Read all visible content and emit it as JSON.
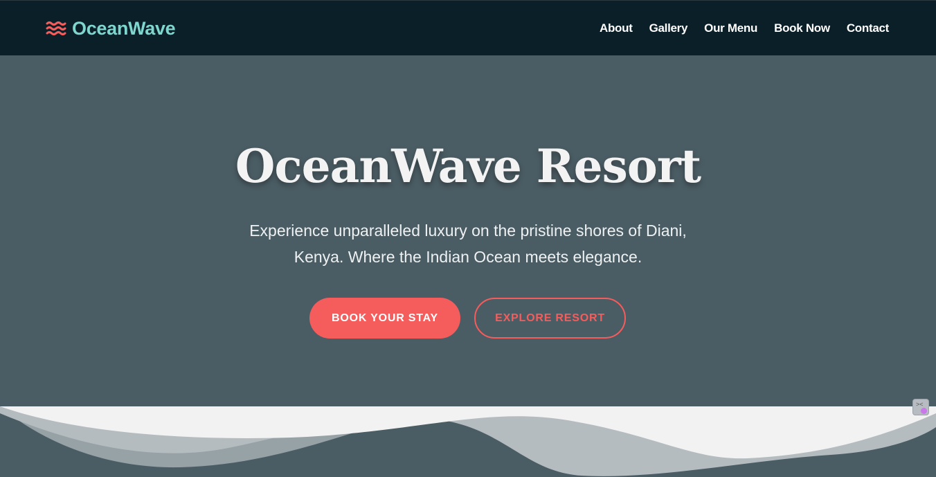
{
  "brand": {
    "name": "OceanWave",
    "icon": "waves-icon",
    "icon_color": "#f55d5d",
    "text_color": "#7fd6cf"
  },
  "nav": {
    "items": [
      {
        "label": "About"
      },
      {
        "label": "Gallery"
      },
      {
        "label": "Our Menu"
      },
      {
        "label": "Book Now"
      },
      {
        "label": "Contact"
      }
    ]
  },
  "hero": {
    "title": "OceanWave Resort",
    "subtitle": "Experience unparalleled luxury on the pristine shores of Diani, Kenya. Where the Indian Ocean meets elegance.",
    "primary_button": "BOOK YOUR STAY",
    "secondary_button": "EXPLORE RESORT"
  },
  "colors": {
    "navbar_bg": "#0b1f28",
    "hero_bg": "#4b5d64",
    "accent": "#f55d5d",
    "wave_light": "#f2f2f2",
    "wave_mid": "#b5bcc0"
  },
  "widgets": {
    "corner_icon": "expand-icon"
  }
}
